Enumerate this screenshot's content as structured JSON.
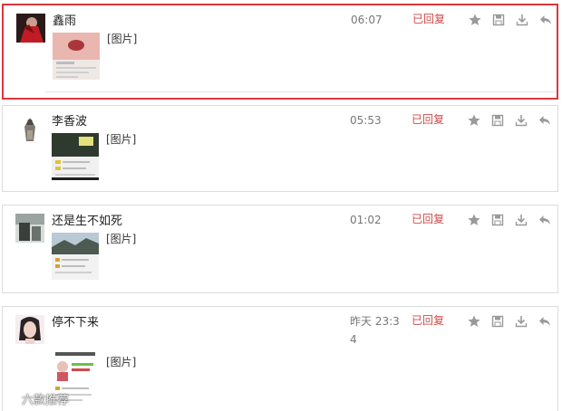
{
  "messages": [
    {
      "name": "鑫雨",
      "image_label": "[图片]",
      "time": "06:07",
      "status": "已回复",
      "selected": true
    },
    {
      "name": "李香波",
      "image_label": "[图片]",
      "time": "05:53",
      "status": "已回复",
      "selected": false
    },
    {
      "name": "还是生不如死",
      "image_label": "[图片]",
      "time": "01:02",
      "status": "已回复",
      "selected": false
    },
    {
      "name": "停不下来",
      "image_label": "[图片]",
      "time": "昨天 23:34",
      "status": "已回复",
      "selected": false
    }
  ],
  "actions": {
    "star_icon": "star-icon",
    "save_icon": "save-icon",
    "download_icon": "download-icon",
    "reply_icon": "reply-icon"
  },
  "watermark": "六款推荐",
  "colors": {
    "selected_border": "#d9373b",
    "status_text": "#d24a4a",
    "icon": "#9a9a9a",
    "card_border": "#dcdcdc"
  }
}
